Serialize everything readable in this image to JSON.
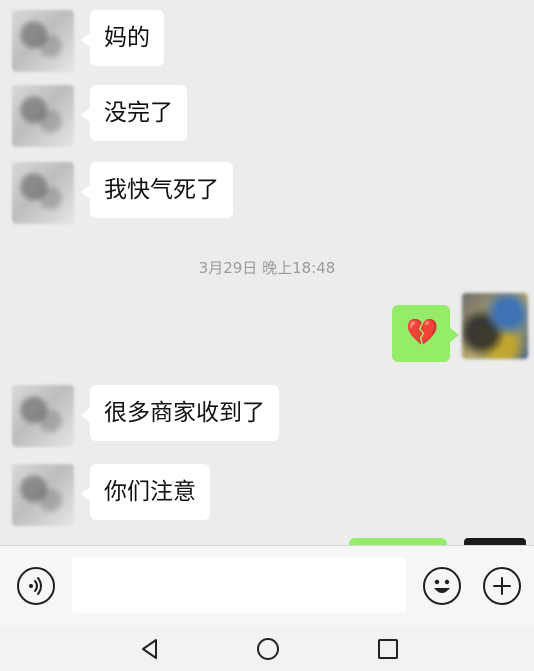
{
  "messages": {
    "m1": "妈的",
    "m2": "没完了",
    "m3": "我快气死了",
    "m4": "💔",
    "m5": "很多商家收到了",
    "m6": "你们注意"
  },
  "timestamp": "3月29日 晚上18:48",
  "input": {
    "value": "",
    "placeholder": ""
  },
  "icons": {
    "voice": "voice-icon",
    "emoji": "emoji-icon",
    "plus": "plus-icon",
    "back": "nav-back-icon",
    "home": "nav-home-icon",
    "recent": "nav-recent-icon"
  },
  "colors": {
    "chat_background": "#ececec",
    "incoming_bubble": "#ffffff",
    "outgoing_bubble": "#95ec69",
    "timestamp_text": "#9b9b9b",
    "icon_stroke": "#1f1f1f"
  }
}
